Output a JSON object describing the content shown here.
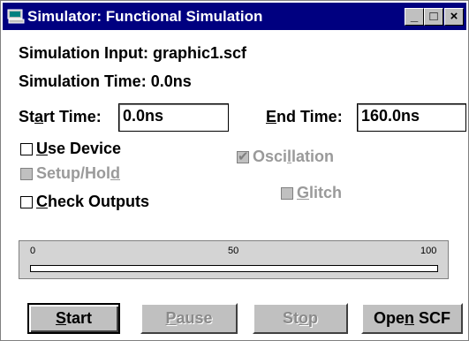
{
  "window": {
    "title": "Simulator: Functional Simulation",
    "minimize": "_",
    "maximize": "□",
    "close": "×"
  },
  "info": {
    "input_label": "Simulation Input:",
    "input_value": "graphic1.scf",
    "time_label": "Simulation Time:",
    "time_value": "0.0ns"
  },
  "start_time": {
    "label_pre": "St",
    "label_ul": "a",
    "label_post": "rt Time:",
    "value": "0.0ns"
  },
  "end_time": {
    "label_ul": "E",
    "label_post": "nd Time:",
    "value": "160.0ns"
  },
  "options": {
    "use_device": {
      "ul": "U",
      "rest": "se Device",
      "checked": false,
      "enabled": true
    },
    "setup_hold": {
      "pre": "Setup/Hol",
      "ul": "d",
      "checked": false,
      "enabled": false
    },
    "check_outputs": {
      "ul": "C",
      "rest": "heck Outputs",
      "checked": false,
      "enabled": true
    },
    "oscillation": {
      "pre": "Osci",
      "ul": "l",
      "rest": "lation",
      "checked": true,
      "enabled": false
    },
    "glitch": {
      "ul": "G",
      "rest": "litch",
      "checked": false,
      "enabled": false
    }
  },
  "progress": {
    "tick_start": "0",
    "tick_mid": "50",
    "tick_end": "100",
    "percent": 0
  },
  "buttons": {
    "start": {
      "ul": "S",
      "rest": "tart"
    },
    "pause": {
      "ul": "P",
      "rest": "ause"
    },
    "stop": {
      "pre": "St",
      "ul": "o",
      "rest": "p"
    },
    "open_scf": {
      "pre": "Ope",
      "ul": "n",
      "rest": " SCF"
    }
  }
}
